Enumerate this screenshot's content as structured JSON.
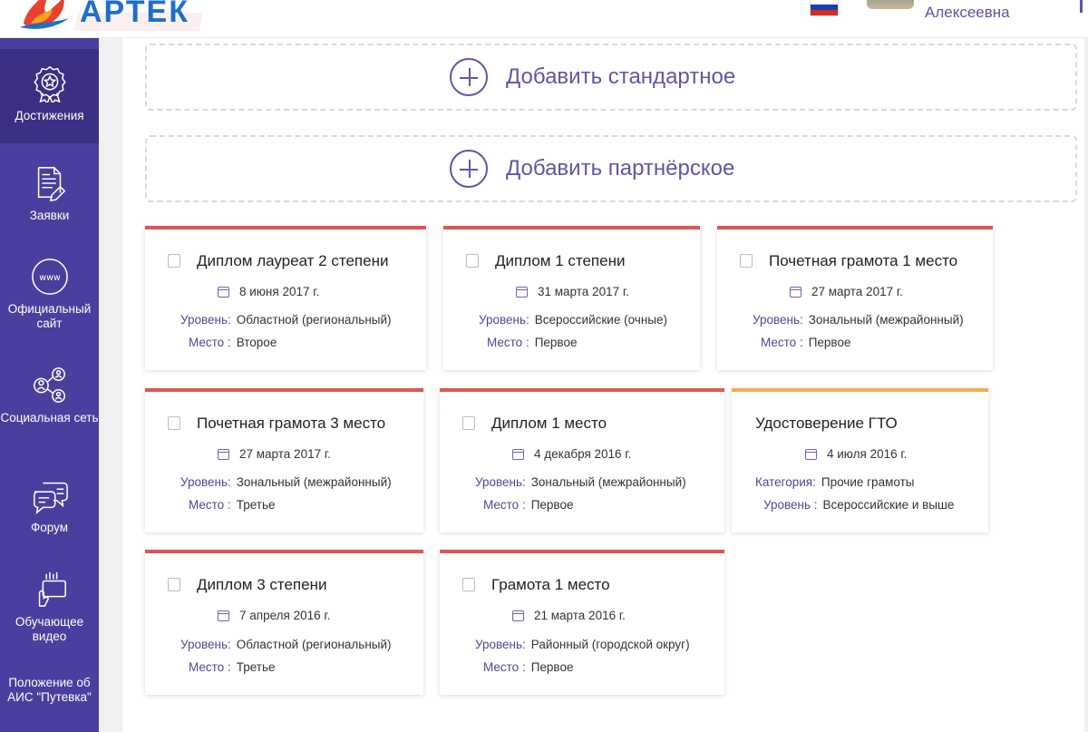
{
  "header": {
    "logo_text": "АРТЕК",
    "user_name": "Алексеевна"
  },
  "sidebar": {
    "items": [
      {
        "label": "Достижения",
        "icon": "medal-icon",
        "active": true
      },
      {
        "label": "Заявки",
        "icon": "document-edit-icon",
        "active": false
      },
      {
        "label": "Официальный сайт",
        "icon": "www-icon",
        "active": false
      },
      {
        "label": "Социальная сеть",
        "icon": "users-network-icon",
        "active": false
      },
      {
        "label": "Форум",
        "icon": "chat-bubbles-icon",
        "active": false
      },
      {
        "label": "Обучающее видео",
        "icon": "touch-screen-icon",
        "active": false
      },
      {
        "label": "Положение об АИС \"Путевка\"",
        "icon": "",
        "active": false
      }
    ]
  },
  "actions": {
    "add_standard": "Добавить стандартное",
    "add_partner": "Добавить партнёрское"
  },
  "colors": {
    "brand": "#4a3f9e",
    "card_top_red": "#e05656",
    "card_top_orange": "#f0ad55",
    "accent_text": "#5d58a4"
  },
  "cards": [
    {
      "title": "Диплом лауреат 2 степени",
      "date": "8 июня 2017 г.",
      "label1": "Уровень:",
      "value1": "Областной (региональный)",
      "label2": "Место :",
      "value2": "Второе",
      "checkbox": true
    },
    {
      "title": "Диплом 1 степени",
      "date": "31 марта 2017 г.",
      "label1": "Уровень:",
      "value1": "Всероссийские (очные)",
      "label2": "Место :",
      "value2": "Первое",
      "checkbox": true
    },
    {
      "title": "Почетная грамота 1 место",
      "date": "27 марта 2017 г.",
      "label1": "Уровень:",
      "value1": "Зональный (межрайонный)",
      "label2": "Место :",
      "value2": "Первое",
      "checkbox": true
    },
    {
      "title": "Почетная грамота 3 место",
      "date": "27 марта 2017 г.",
      "label1": "Уровень:",
      "value1": "Зональный (межрайонный)",
      "label2": "Место :",
      "value2": "Третье",
      "checkbox": true
    },
    {
      "title": "Диплом 1 место",
      "date": "4 декабря 2016 г.",
      "label1": "Уровень:",
      "value1": "Зональный (межрайонный)",
      "label2": "Место :",
      "value2": "Первое",
      "checkbox": true
    },
    {
      "title": "Удостоверение ГТО",
      "date": "4 июля 2016 г.",
      "label1": "Категория:",
      "value1": "Прочие грамоты",
      "label2": "Уровень :",
      "value2": "Всероссийские и выше",
      "checkbox": false
    },
    {
      "title": "Диплом 3 степени",
      "date": "7 апреля 2016 г.",
      "label1": "Уровень:",
      "value1": "Областной (региональный)",
      "label2": "Место :",
      "value2": "Третье",
      "checkbox": true
    },
    {
      "title": "Грамота 1 место",
      "date": "21 марта 2016 г.",
      "label1": "Уровень:",
      "value1": "Районный (городской округ)",
      "label2": "Место :",
      "value2": "Первое",
      "checkbox": true
    }
  ]
}
